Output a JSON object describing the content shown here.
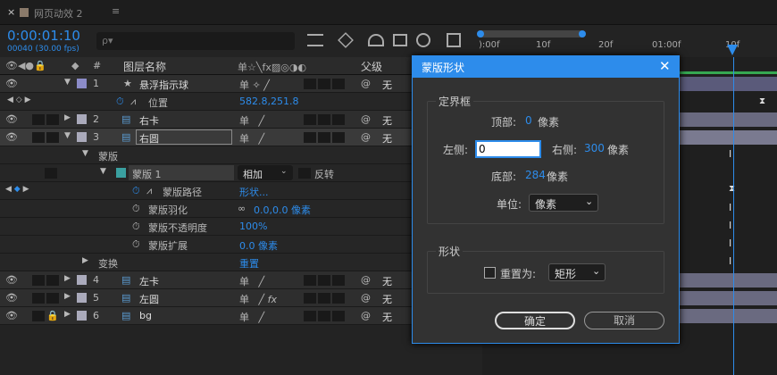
{
  "tab": {
    "close": "×",
    "title": "网页动效 2",
    "menu": "≡"
  },
  "time": {
    "timecode": "0:00:01:10",
    "frames": "00040 (30.00 fps)",
    "search_placeholder": "ρ▾"
  },
  "ruler": {
    "labels": [
      "):00f",
      "10f",
      "20f",
      "01:00f",
      "10f"
    ]
  },
  "columns": {
    "num": "#",
    "layer_name": "图层名称",
    "parent": "父级"
  },
  "layers": [
    {
      "num": "1",
      "name": "悬浮指示球",
      "parent": "无"
    },
    {
      "num": "2",
      "name": "右卡",
      "parent": "无"
    },
    {
      "num": "3",
      "name": "右圆",
      "parent": "无"
    },
    {
      "num": "4",
      "name": "左卡",
      "parent": "无"
    },
    {
      "num": "5",
      "name": "左圆",
      "parent": "无"
    },
    {
      "num": "6",
      "name": "bg",
      "parent": "无"
    }
  ],
  "props": {
    "position_label": "位置",
    "position_value": "582.8,251.8",
    "masks": "蒙版",
    "mask1": "蒙版 1",
    "mask_mode": "相加",
    "invert": "反转",
    "mask_path": "蒙版路径",
    "mask_path_value": "形状...",
    "mask_feather": "蒙版羽化",
    "mask_feather_value": "0.0,0.0 像素",
    "mask_opacity": "蒙版不透明度",
    "mask_opacity_value": "100%",
    "mask_expand": "蒙版扩展",
    "mask_expand_value": "0.0 像素",
    "transform": "变换",
    "reset": "重置"
  },
  "dialog": {
    "title": "蒙版形状",
    "bbox_group": "定界框",
    "top_label": "顶部:",
    "top_value": "0",
    "top_unit": "像素",
    "left_label": "左侧:",
    "left_value": "0",
    "right_label": "右侧:",
    "right_value": "300",
    "right_unit": "像素",
    "bottom_label": "底部:",
    "bottom_value": "284",
    "bottom_unit": "像素",
    "unit_label": "单位:",
    "unit_value": "像素",
    "shape_group": "形状",
    "reset_to_label": "重置为:",
    "shape_value": "矩形",
    "ok": "确定",
    "cancel": "取消"
  },
  "colors": {
    "accent": "#2d8ceb",
    "label_purple": "#8c8cc8",
    "label_teal": "#3aa0a0"
  }
}
